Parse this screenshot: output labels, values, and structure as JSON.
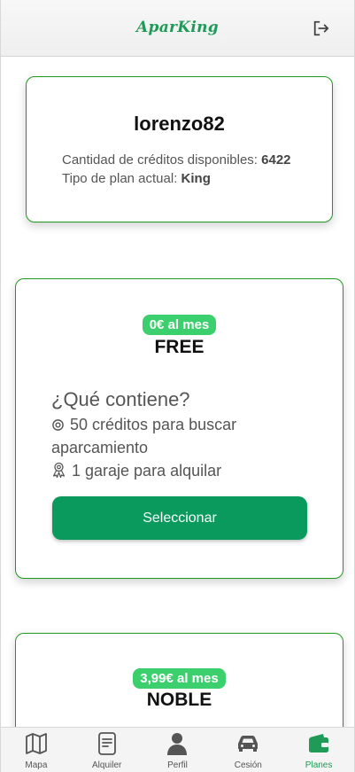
{
  "header": {
    "logo_text": "AparKing",
    "logout_icon": "logout-icon"
  },
  "user": {
    "username": "lorenzo82",
    "credits_label": "Cantidad de créditos disponibles: ",
    "credits_value": "6422",
    "plan_label": "Tipo de plan actual: ",
    "plan_value": "King"
  },
  "plans": [
    {
      "price": "0€ al mes",
      "name": "FREE",
      "contains_title": "¿Qué contiene?",
      "feature_search": "50 créditos para buscar aparcamiento",
      "feature_garage": "1 garaje para alquilar",
      "select_label": "Seleccionar"
    },
    {
      "price": "3,99€ al mes",
      "name": "NOBLE"
    }
  ],
  "nav": [
    {
      "label": "Mapa",
      "icon": "map-icon"
    },
    {
      "label": "Alquiler",
      "icon": "document-icon"
    },
    {
      "label": "Perfil",
      "icon": "person-icon"
    },
    {
      "label": "Cesión",
      "icon": "car-icon"
    },
    {
      "label": "Planes",
      "icon": "wallet-icon"
    }
  ],
  "colors": {
    "accent": "#1f9a57",
    "button": "#0a9a5e",
    "badge": "#3ccf6e",
    "card_border": "#1f9a1f"
  }
}
